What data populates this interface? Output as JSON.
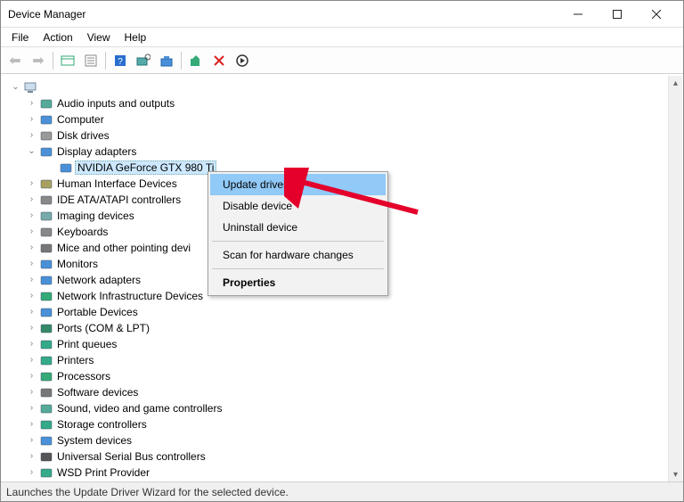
{
  "window": {
    "title": "Device Manager"
  },
  "menubar": [
    "File",
    "Action",
    "View",
    "Help"
  ],
  "tree": {
    "root": "",
    "nodes": [
      {
        "label": "Audio inputs and outputs",
        "icon": "audio"
      },
      {
        "label": "Computer",
        "icon": "computer"
      },
      {
        "label": "Disk drives",
        "icon": "disk"
      },
      {
        "label": "Display adapters",
        "icon": "display",
        "expanded": true,
        "children": [
          {
            "label": "NVIDIA GeForce GTX 980 Ti",
            "icon": "display",
            "selected": true
          }
        ]
      },
      {
        "label": "Human Interface Devices",
        "icon": "hid"
      },
      {
        "label": "IDE ATA/ATAPI controllers",
        "icon": "ide"
      },
      {
        "label": "Imaging devices",
        "icon": "imaging"
      },
      {
        "label": "Keyboards",
        "icon": "keyboard"
      },
      {
        "label": "Mice and other pointing devices",
        "icon": "mouse",
        "truncated": "Mice and other pointing devi"
      },
      {
        "label": "Monitors",
        "icon": "monitor"
      },
      {
        "label": "Network adapters",
        "icon": "network"
      },
      {
        "label": "Network Infrastructure Devices",
        "icon": "netinfra"
      },
      {
        "label": "Portable Devices",
        "icon": "portable"
      },
      {
        "label": "Ports (COM & LPT)",
        "icon": "ports"
      },
      {
        "label": "Print queues",
        "icon": "printq"
      },
      {
        "label": "Printers",
        "icon": "printer"
      },
      {
        "label": "Processors",
        "icon": "cpu"
      },
      {
        "label": "Software devices",
        "icon": "software"
      },
      {
        "label": "Sound, video and game controllers",
        "icon": "sound"
      },
      {
        "label": "Storage controllers",
        "icon": "storage"
      },
      {
        "label": "System devices",
        "icon": "system"
      },
      {
        "label": "Universal Serial Bus controllers",
        "icon": "usb"
      },
      {
        "label": "WSD Print Provider",
        "icon": "wsd"
      }
    ]
  },
  "context_menu": {
    "items": [
      {
        "label": "Update driver",
        "highlight": true
      },
      {
        "label": "Disable device"
      },
      {
        "label": "Uninstall device"
      },
      {
        "separator": true
      },
      {
        "label": "Scan for hardware changes"
      },
      {
        "separator": true
      },
      {
        "label": "Properties",
        "bold": true
      }
    ]
  },
  "statusbar": "Launches the Update Driver Wizard for the selected device."
}
